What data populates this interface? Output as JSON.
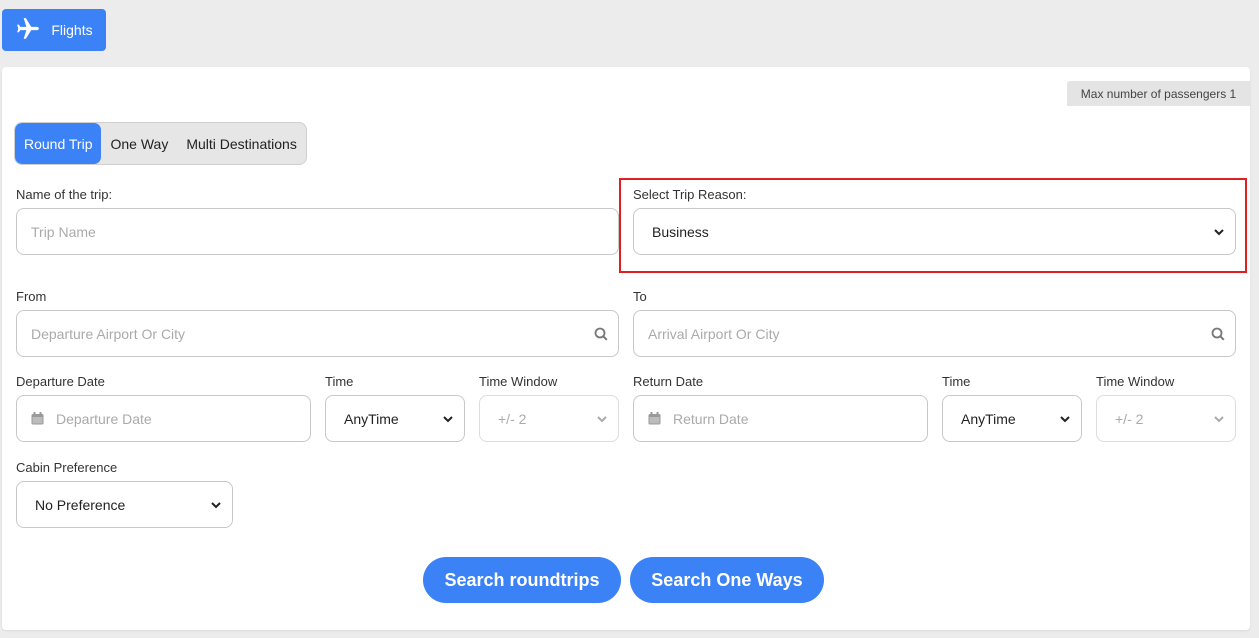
{
  "header": {
    "tab_label": "Flights",
    "tab_icon": "plane-icon"
  },
  "panel": {
    "max_passengers": "Max number of passengers 1",
    "trip_types": [
      "Round Trip",
      "One Way",
      "Multi Destinations"
    ],
    "active_trip_type": "Round Trip",
    "trip_name": {
      "label": "Name of the trip:",
      "placeholder": "Trip Name",
      "value": ""
    },
    "trip_reason": {
      "label": "Select Trip Reason:",
      "value": "Business"
    },
    "from": {
      "label": "From",
      "placeholder": "Departure Airport Or City"
    },
    "to": {
      "label": "To",
      "placeholder": "Arrival Airport Or City"
    },
    "departure": {
      "date_label": "Departure Date",
      "date_placeholder": "Departure Date",
      "time_label": "Time",
      "time_value": "AnyTime",
      "window_label": "Time Window",
      "window_value": "+/- 2"
    },
    "return": {
      "date_label": "Return Date",
      "date_placeholder": "Return Date",
      "time_label": "Time",
      "time_value": "AnyTime",
      "window_label": "Time Window",
      "window_value": "+/- 2"
    },
    "cabin": {
      "label": "Cabin Preference",
      "value": "No Preference"
    },
    "buttons": {
      "search_roundtrips": "Search roundtrips",
      "search_one_ways": "Search One Ways"
    }
  },
  "colors": {
    "accent": "#3b82f6",
    "highlight": "#e02020"
  }
}
